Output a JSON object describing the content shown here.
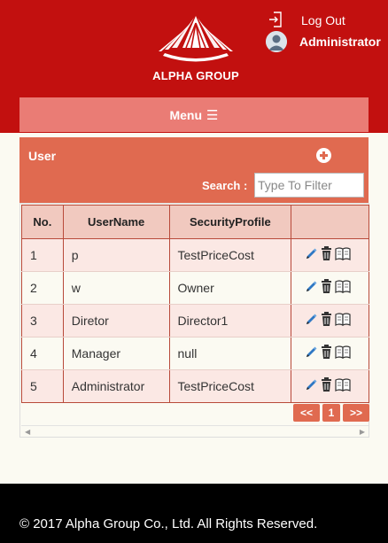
{
  "header": {
    "brand_name": "ALPHA GROUP",
    "logout_label": "Log Out",
    "user_name": "Administrator"
  },
  "menu": {
    "label": "Menu"
  },
  "panel": {
    "title": "User",
    "search_label": "Search :",
    "search_placeholder": "Type To Filter"
  },
  "table": {
    "columns": [
      "No.",
      "UserName",
      "SecurityProfile",
      ""
    ],
    "rows": [
      {
        "no": "1",
        "username": "p",
        "profile": "TestPriceCost"
      },
      {
        "no": "2",
        "username": "w",
        "profile": "Owner"
      },
      {
        "no": "3",
        "username": "Diretor",
        "profile": "Director1"
      },
      {
        "no": "4",
        "username": "Manager",
        "profile": "null"
      },
      {
        "no": "5",
        "username": "Administrator",
        "profile": "TestPriceCost"
      }
    ],
    "row_action_icons": [
      "pencil-edit-icon",
      "trash-icon",
      "book-icon"
    ]
  },
  "pager": {
    "prev": "<<",
    "page": "1",
    "next": ">>"
  },
  "footer": {
    "copyright": "© 2017 Alpha Group Co., Ltd. All Rights Reserved."
  },
  "colors": {
    "header_red": "#c2100f",
    "menu_pink": "#ea7c75",
    "panel_orange": "#e06a50",
    "table_header": "#f1c9bf",
    "footer_black": "#000000"
  }
}
